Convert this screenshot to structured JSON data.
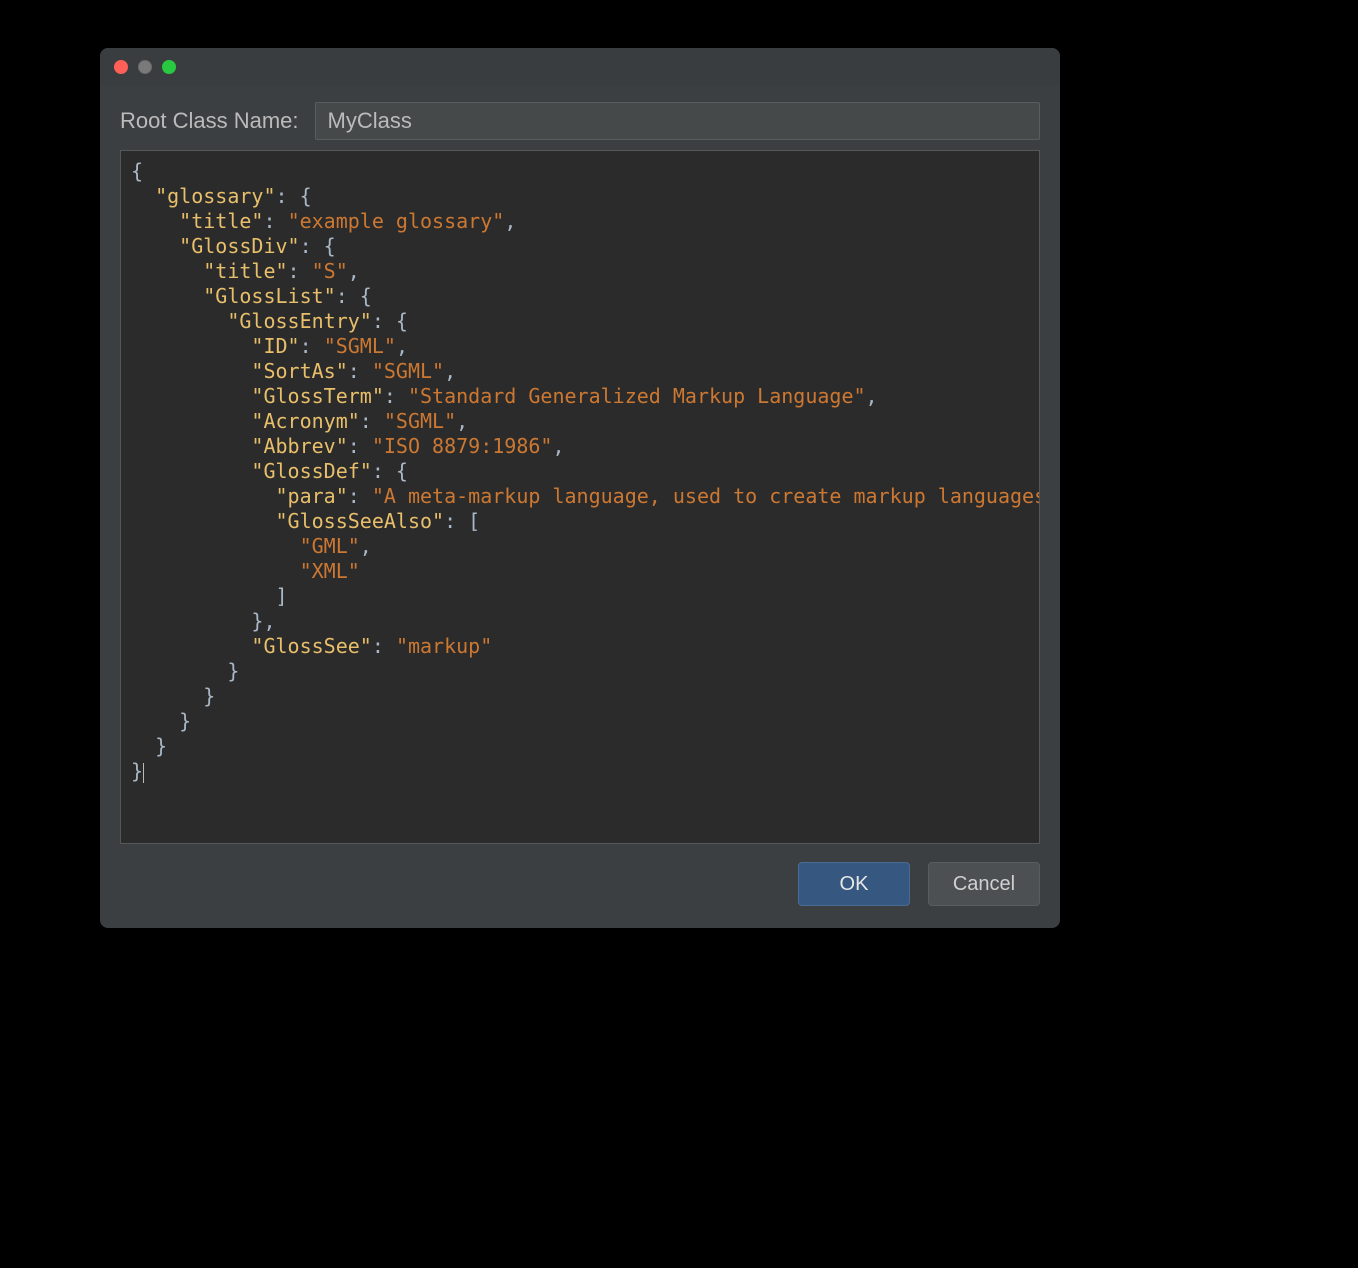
{
  "header": {
    "label": "Root Class Name:",
    "value": "MyClass"
  },
  "code": {
    "tokens": [
      {
        "t": "p",
        "v": "{\n"
      },
      {
        "t": "p",
        "v": "  "
      },
      {
        "t": "k",
        "v": "\"glossary\""
      },
      {
        "t": "p",
        "v": ": {\n"
      },
      {
        "t": "p",
        "v": "    "
      },
      {
        "t": "k",
        "v": "\"title\""
      },
      {
        "t": "p",
        "v": ": "
      },
      {
        "t": "s",
        "v": "\"example glossary\""
      },
      {
        "t": "p",
        "v": ",\n"
      },
      {
        "t": "p",
        "v": "    "
      },
      {
        "t": "k",
        "v": "\"GlossDiv\""
      },
      {
        "t": "p",
        "v": ": {\n"
      },
      {
        "t": "p",
        "v": "      "
      },
      {
        "t": "k",
        "v": "\"title\""
      },
      {
        "t": "p",
        "v": ": "
      },
      {
        "t": "s",
        "v": "\"S\""
      },
      {
        "t": "p",
        "v": ",\n"
      },
      {
        "t": "p",
        "v": "      "
      },
      {
        "t": "k",
        "v": "\"GlossList\""
      },
      {
        "t": "p",
        "v": ": {\n"
      },
      {
        "t": "p",
        "v": "        "
      },
      {
        "t": "k",
        "v": "\"GlossEntry\""
      },
      {
        "t": "p",
        "v": ": {\n"
      },
      {
        "t": "p",
        "v": "          "
      },
      {
        "t": "k",
        "v": "\"ID\""
      },
      {
        "t": "p",
        "v": ": "
      },
      {
        "t": "s",
        "v": "\"SGML\""
      },
      {
        "t": "p",
        "v": ",\n"
      },
      {
        "t": "p",
        "v": "          "
      },
      {
        "t": "k",
        "v": "\"SortAs\""
      },
      {
        "t": "p",
        "v": ": "
      },
      {
        "t": "s",
        "v": "\"SGML\""
      },
      {
        "t": "p",
        "v": ",\n"
      },
      {
        "t": "p",
        "v": "          "
      },
      {
        "t": "k",
        "v": "\"GlossTerm\""
      },
      {
        "t": "p",
        "v": ": "
      },
      {
        "t": "s",
        "v": "\"Standard Generalized Markup Language\""
      },
      {
        "t": "p",
        "v": ",\n"
      },
      {
        "t": "p",
        "v": "          "
      },
      {
        "t": "k",
        "v": "\"Acronym\""
      },
      {
        "t": "p",
        "v": ": "
      },
      {
        "t": "s",
        "v": "\"SGML\""
      },
      {
        "t": "p",
        "v": ",\n"
      },
      {
        "t": "p",
        "v": "          "
      },
      {
        "t": "k",
        "v": "\"Abbrev\""
      },
      {
        "t": "p",
        "v": ": "
      },
      {
        "t": "s",
        "v": "\"ISO 8879:1986\""
      },
      {
        "t": "p",
        "v": ",\n"
      },
      {
        "t": "p",
        "v": "          "
      },
      {
        "t": "k",
        "v": "\"GlossDef\""
      },
      {
        "t": "p",
        "v": ": {\n"
      },
      {
        "t": "p",
        "v": "            "
      },
      {
        "t": "k",
        "v": "\"para\""
      },
      {
        "t": "p",
        "v": ": "
      },
      {
        "t": "s",
        "v": "\"A meta-markup language, used to create markup languages such as DocBook.\""
      },
      {
        "t": "p",
        "v": ",\n"
      },
      {
        "t": "p",
        "v": "            "
      },
      {
        "t": "k",
        "v": "\"GlossSeeAlso\""
      },
      {
        "t": "p",
        "v": ": [\n"
      },
      {
        "t": "p",
        "v": "              "
      },
      {
        "t": "s",
        "v": "\"GML\""
      },
      {
        "t": "p",
        "v": ",\n"
      },
      {
        "t": "p",
        "v": "              "
      },
      {
        "t": "s",
        "v": "\"XML\""
      },
      {
        "t": "p",
        "v": "\n"
      },
      {
        "t": "p",
        "v": "            ]\n"
      },
      {
        "t": "p",
        "v": "          },\n"
      },
      {
        "t": "p",
        "v": "          "
      },
      {
        "t": "k",
        "v": "\"GlossSee\""
      },
      {
        "t": "p",
        "v": ": "
      },
      {
        "t": "s",
        "v": "\"markup\""
      },
      {
        "t": "p",
        "v": "\n"
      },
      {
        "t": "p",
        "v": "        }\n"
      },
      {
        "t": "p",
        "v": "      }\n"
      },
      {
        "t": "p",
        "v": "    }\n"
      },
      {
        "t": "p",
        "v": "  }\n"
      },
      {
        "t": "p",
        "v": "}"
      }
    ]
  },
  "footer": {
    "ok_label": "OK",
    "cancel_label": "Cancel"
  }
}
